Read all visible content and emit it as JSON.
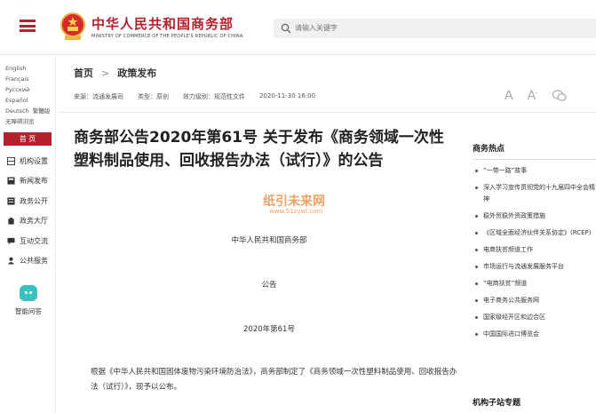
{
  "header": {
    "title": "中华人民共和国商务部",
    "subtitle": "MINISTRY OF COMMERCE OF THE PEOPLE'S REPUBLIC OF CHINA",
    "search_placeholder": "请输入关键字"
  },
  "sidebar": {
    "languages": [
      "English",
      "Français",
      "Русский",
      "Español",
      "Deutsch",
      "繁體版",
      "无障碍浏览"
    ],
    "nav": [
      {
        "label": "首  页",
        "icon": "home"
      },
      {
        "label": "机构设置",
        "icon": "org-chart-icon"
      },
      {
        "label": "新闻发布",
        "icon": "news-icon"
      },
      {
        "label": "政务公开",
        "icon": "document-icon"
      },
      {
        "label": "政务大厅",
        "icon": "hall-icon"
      },
      {
        "label": "互动交流",
        "icon": "chat-icon"
      },
      {
        "label": "公共服务",
        "icon": "service-icon"
      }
    ],
    "ai_label": "智能问答"
  },
  "breadcrumb": {
    "home": "首页",
    "sep": ">",
    "current": "政策发布"
  },
  "meta": {
    "source": "来源：流通发展司",
    "type": "类型：原创",
    "level": "效力级别：规范性文件",
    "date": "2020-11-30 16:00"
  },
  "article": {
    "title": "商务部公告2020年第61号 关于发布《商务领域一次性塑料制品使用、回收报告办法（试行）》的公告",
    "issuer": "中华人民共和国商务部",
    "kind": "公告",
    "number": "2020年第61号",
    "para": "根据《中华人民共和国固体废物污染环境防治法》，商务部制定了《商务领域一次性塑料制品使用、回收报告办法（试行）》，现予以公布。"
  },
  "watermark": {
    "text": "纸引未来网",
    "url": "www.51zywl.com"
  },
  "right": {
    "hot_title": "商务热点",
    "hot_items": [
      "“一带一路”故事",
      "深入学习宣传贯彻党的十九届四中全会精神",
      "稳外贸稳外资政策措施",
      "《区域全面经济伙伴关系协定》(RCEP)",
      "电商扶贫频道工作",
      "市场运行与流通发展服务平台",
      "“电商扶贫”频道",
      "电子商务公共服务网",
      "国家级经开区和边合区",
      "中国国际进口博览会"
    ],
    "subsite_title": "机构子站专题"
  },
  "colors": {
    "brand": "#b5202d",
    "accent_ai": "#3bbfc1"
  }
}
